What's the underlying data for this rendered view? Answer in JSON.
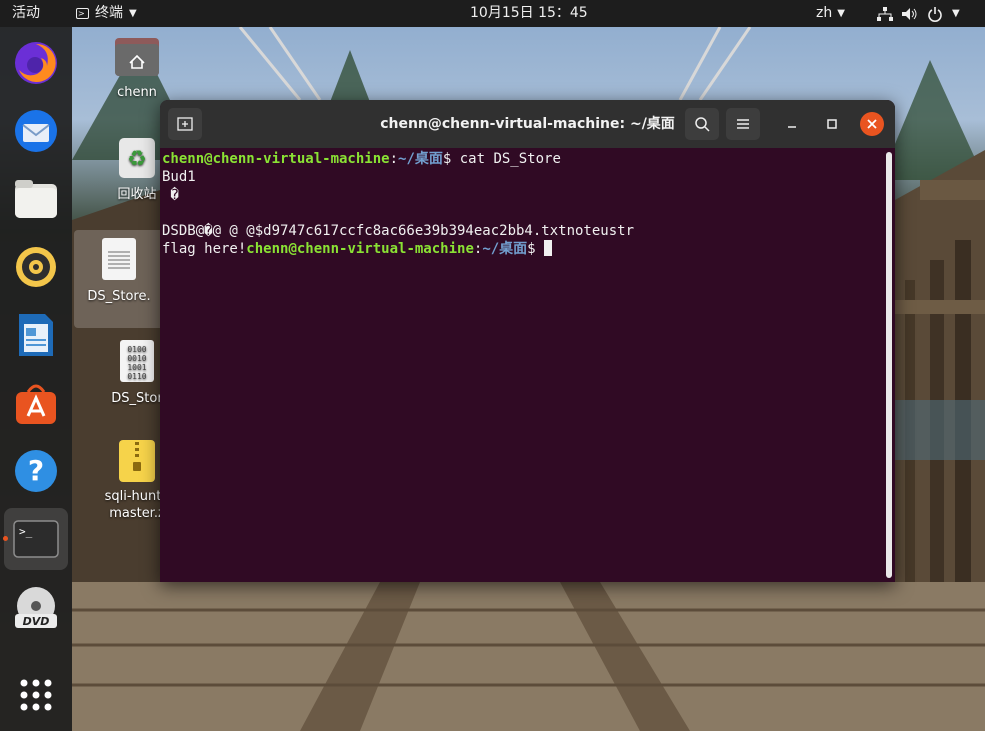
{
  "topbar": {
    "activities": "活动",
    "app_menu": "终端",
    "clock": "10月15日  15：45",
    "lang": "zh"
  },
  "dock": {
    "items": [
      {
        "name": "firefox",
        "icon": "firefox-icon"
      },
      {
        "name": "thunderbird",
        "icon": "thunderbird-icon"
      },
      {
        "name": "files",
        "icon": "folder-icon"
      },
      {
        "name": "rhythmbox",
        "icon": "speaker-icon"
      },
      {
        "name": "writer",
        "icon": "document-icon"
      },
      {
        "name": "software",
        "icon": "store-icon"
      },
      {
        "name": "help",
        "icon": "help-icon"
      },
      {
        "name": "terminal",
        "icon": "terminal-icon"
      },
      {
        "name": "dvd",
        "icon": "dvd-icon"
      },
      {
        "name": "show-apps",
        "icon": "grid-icon"
      }
    ]
  },
  "desktop": {
    "icons": [
      {
        "label": "chenn"
      },
      {
        "label": "回收站"
      },
      {
        "label": "DS_Store."
      },
      {
        "label": "DS_Stor"
      },
      {
        "label1": "sqli-hunte",
        "label2": "master.z"
      }
    ]
  },
  "terminal": {
    "title": "chenn@chenn-virtual-machine: ~/桌面",
    "prompt_user": "chenn@chenn-virtual-machine",
    "prompt_sep": ":",
    "prompt_path": "~/桌面",
    "prompt_dollar": "$ ",
    "command": "cat DS_Store",
    "output_line1": "Bud1",
    "output_line2": " �",
    "output_line3": "",
    "output_line4": "DSDB@�@ @ @$d9747c617ccfc8ac66e39b394eac2bb4.txtnoteustr",
    "output_line5_prefix": "flag here!"
  },
  "colors": {
    "terminal_bg": "#300a24",
    "prompt_user": "#8ae234",
    "prompt_path": "#729fcf",
    "close_button": "#e95420"
  }
}
